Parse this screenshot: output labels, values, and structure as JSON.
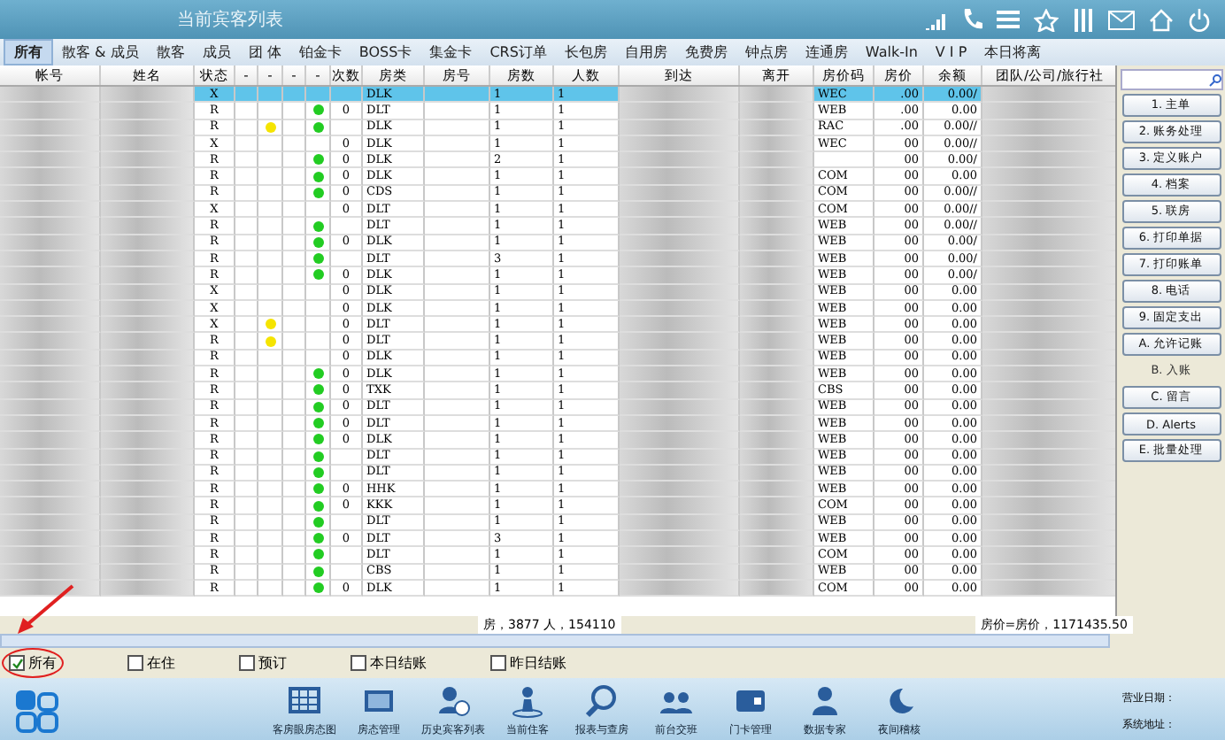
{
  "window": {
    "title": "当前宾客列表"
  },
  "tabs": [
    {
      "label": "所有",
      "selected": true
    },
    {
      "label": "散客 & 成员",
      "selected": false
    },
    {
      "label": "散客",
      "selected": false
    },
    {
      "label": "成员",
      "selected": false
    },
    {
      "label": "团 体",
      "selected": false
    },
    {
      "label": "铂金卡",
      "selected": false
    },
    {
      "label": "BOSS卡",
      "selected": false
    },
    {
      "label": "集金卡",
      "selected": false
    },
    {
      "label": "CRS订单",
      "selected": false
    },
    {
      "label": "长包房",
      "selected": false
    },
    {
      "label": "自用房",
      "selected": false
    },
    {
      "label": "免费房",
      "selected": false
    },
    {
      "label": "钟点房",
      "selected": false
    },
    {
      "label": "连通房",
      "selected": false
    },
    {
      "label": "Walk-In",
      "selected": false
    },
    {
      "label": "V I P",
      "selected": false
    },
    {
      "label": "本日将离",
      "selected": false
    }
  ],
  "table": {
    "columns": [
      "帐号",
      "姓名",
      "状态",
      "-",
      "-",
      "-",
      "-",
      "次数",
      "房类",
      "房号",
      "房数",
      "人数",
      "到达",
      "离开",
      "房价码",
      "房价",
      "余额",
      "团队/公司/旅行社"
    ],
    "rows": [
      {
        "status": "X",
        "yellow_dot": false,
        "green_dot": false,
        "count": "",
        "room_type": "DLK",
        "rooms": "1",
        "people": "1",
        "rate_code": "WEC",
        "rate": ".00",
        "balance": "0.00/",
        "selected": true
      },
      {
        "status": "R",
        "yellow_dot": false,
        "green_dot": true,
        "count": "0",
        "room_type": "DLT",
        "rooms": "1",
        "people": "1",
        "rate_code": "WEB",
        "rate": ".00",
        "balance": "0.00",
        "selected": false
      },
      {
        "status": "R",
        "yellow_dot": true,
        "green_dot": true,
        "count": "",
        "room_type": "DLK",
        "rooms": "1",
        "people": "1",
        "rate_code": "RAC",
        "rate": ".00",
        "balance": "0.00//",
        "selected": false
      },
      {
        "status": "X",
        "yellow_dot": false,
        "green_dot": false,
        "count": "0",
        "room_type": "DLK",
        "rooms": "1",
        "people": "1",
        "rate_code": "WEC",
        "rate": "00",
        "balance": "0.00//",
        "selected": false
      },
      {
        "status": "R",
        "yellow_dot": false,
        "green_dot": true,
        "count": "0",
        "room_type": "DLK",
        "rooms": "2",
        "people": "1",
        "rate_code": "",
        "rate": "00",
        "balance": "0.00/",
        "selected": false
      },
      {
        "status": "R",
        "yellow_dot": false,
        "green_dot": true,
        "count": "0",
        "room_type": "DLK",
        "rooms": "1",
        "people": "1",
        "rate_code": "COM",
        "rate": "00",
        "balance": "0.00",
        "selected": false
      },
      {
        "status": "R",
        "yellow_dot": false,
        "green_dot": true,
        "count": "0",
        "room_type": "CDS",
        "rooms": "1",
        "people": "1",
        "rate_code": "COM",
        "rate": "00",
        "balance": "0.00//",
        "selected": false
      },
      {
        "status": "X",
        "yellow_dot": false,
        "green_dot": false,
        "count": "0",
        "room_type": "DLT",
        "rooms": "1",
        "people": "1",
        "rate_code": "COM",
        "rate": "00",
        "balance": "0.00//",
        "selected": false
      },
      {
        "status": "R",
        "yellow_dot": false,
        "green_dot": true,
        "count": "",
        "room_type": "DLT",
        "rooms": "1",
        "people": "1",
        "rate_code": "WEB",
        "rate": "00",
        "balance": "0.00//",
        "selected": false
      },
      {
        "status": "R",
        "yellow_dot": false,
        "green_dot": true,
        "count": "0",
        "room_type": "DLK",
        "rooms": "1",
        "people": "1",
        "rate_code": "WEB",
        "rate": "00",
        "balance": "0.00/",
        "selected": false
      },
      {
        "status": "R",
        "yellow_dot": false,
        "green_dot": true,
        "count": "",
        "room_type": "DLT",
        "rooms": "3",
        "people": "1",
        "rate_code": "WEB",
        "rate": "00",
        "balance": "0.00/",
        "selected": false
      },
      {
        "status": "R",
        "yellow_dot": false,
        "green_dot": true,
        "count": "0",
        "room_type": "DLK",
        "rooms": "1",
        "people": "1",
        "rate_code": "WEB",
        "rate": "00",
        "balance": "0.00/",
        "selected": false
      },
      {
        "status": "X",
        "yellow_dot": false,
        "green_dot": false,
        "count": "0",
        "room_type": "DLK",
        "rooms": "1",
        "people": "1",
        "rate_code": "WEB",
        "rate": "00",
        "balance": "0.00",
        "selected": false
      },
      {
        "status": "X",
        "yellow_dot": false,
        "green_dot": false,
        "count": "0",
        "room_type": "DLK",
        "rooms": "1",
        "people": "1",
        "rate_code": "WEB",
        "rate": "00",
        "balance": "0.00",
        "selected": false
      },
      {
        "status": "X",
        "yellow_dot": true,
        "green_dot": false,
        "count": "0",
        "room_type": "DLT",
        "rooms": "1",
        "people": "1",
        "rate_code": "WEB",
        "rate": "00",
        "balance": "0.00",
        "selected": false
      },
      {
        "status": "R",
        "yellow_dot": true,
        "green_dot": false,
        "count": "0",
        "room_type": "DLT",
        "rooms": "1",
        "people": "1",
        "rate_code": "WEB",
        "rate": "00",
        "balance": "0.00",
        "selected": false
      },
      {
        "status": "R",
        "yellow_dot": false,
        "green_dot": false,
        "count": "0",
        "room_type": "DLK",
        "rooms": "1",
        "people": "1",
        "rate_code": "WEB",
        "rate": "00",
        "balance": "0.00",
        "selected": false
      },
      {
        "status": "R",
        "yellow_dot": false,
        "green_dot": true,
        "count": "0",
        "room_type": "DLK",
        "rooms": "1",
        "people": "1",
        "rate_code": "WEB",
        "rate": "00",
        "balance": "0.00",
        "selected": false
      },
      {
        "status": "R",
        "yellow_dot": false,
        "green_dot": true,
        "count": "0",
        "room_type": "TXK",
        "rooms": "1",
        "people": "1",
        "rate_code": "CBS",
        "rate": "00",
        "balance": "0.00",
        "selected": false
      },
      {
        "status": "R",
        "yellow_dot": false,
        "green_dot": true,
        "count": "0",
        "room_type": "DLT",
        "rooms": "1",
        "people": "1",
        "rate_code": "WEB",
        "rate": "00",
        "balance": "0.00",
        "selected": false
      },
      {
        "status": "R",
        "yellow_dot": false,
        "green_dot": true,
        "count": "0",
        "room_type": "DLT",
        "rooms": "1",
        "people": "1",
        "rate_code": "WEB",
        "rate": "00",
        "balance": "0.00",
        "selected": false
      },
      {
        "status": "R",
        "yellow_dot": false,
        "green_dot": true,
        "count": "0",
        "room_type": "DLK",
        "rooms": "1",
        "people": "1",
        "rate_code": "WEB",
        "rate": "00",
        "balance": "0.00",
        "selected": false
      },
      {
        "status": "R",
        "yellow_dot": false,
        "green_dot": true,
        "count": "",
        "room_type": "DLT",
        "rooms": "1",
        "people": "1",
        "rate_code": "WEB",
        "rate": "00",
        "balance": "0.00",
        "selected": false
      },
      {
        "status": "R",
        "yellow_dot": false,
        "green_dot": true,
        "count": "",
        "room_type": "DLT",
        "rooms": "1",
        "people": "1",
        "rate_code": "WEB",
        "rate": "00",
        "balance": "0.00",
        "selected": false
      },
      {
        "status": "R",
        "yellow_dot": false,
        "green_dot": true,
        "count": "0",
        "room_type": "HHK",
        "rooms": "1",
        "people": "1",
        "rate_code": "WEB",
        "rate": "00",
        "balance": "0.00",
        "selected": false
      },
      {
        "status": "R",
        "yellow_dot": false,
        "green_dot": true,
        "count": "0",
        "room_type": "KKK",
        "rooms": "1",
        "people": "1",
        "rate_code": "COM",
        "rate": "00",
        "balance": "0.00",
        "selected": false
      },
      {
        "status": "R",
        "yellow_dot": false,
        "green_dot": true,
        "count": "",
        "room_type": "DLT",
        "rooms": "1",
        "people": "1",
        "rate_code": "WEB",
        "rate": "00",
        "balance": "0.00",
        "selected": false
      },
      {
        "status": "R",
        "yellow_dot": false,
        "green_dot": true,
        "count": "0",
        "room_type": "DLT",
        "rooms": "3",
        "people": "1",
        "rate_code": "WEB",
        "rate": "00",
        "balance": "0.00",
        "selected": false
      },
      {
        "status": "R",
        "yellow_dot": false,
        "green_dot": true,
        "count": "",
        "room_type": "DLT",
        "rooms": "1",
        "people": "1",
        "rate_code": "COM",
        "rate": "00",
        "balance": "0.00",
        "selected": false
      },
      {
        "status": "R",
        "yellow_dot": false,
        "green_dot": true,
        "count": "",
        "room_type": "CBS",
        "rooms": "1",
        "people": "1",
        "rate_code": "WEB",
        "rate": "00",
        "balance": "0.00",
        "selected": false
      },
      {
        "status": "R",
        "yellow_dot": false,
        "green_dot": true,
        "count": "0",
        "room_type": "DLK",
        "rooms": "1",
        "people": "1",
        "rate_code": "COM",
        "rate": "00",
        "balance": "0.00",
        "selected": false
      }
    ]
  },
  "summary": {
    "rooms_people": "房，3877 人，154110",
    "rate_total": "房价=房价，1171435.50"
  },
  "side_buttons": [
    {
      "label": "1. 主单",
      "disabled": false
    },
    {
      "label": "2. 账务处理",
      "disabled": false
    },
    {
      "label": "3. 定义账户",
      "disabled": false
    },
    {
      "label": "4. 档案",
      "disabled": false
    },
    {
      "label": "5. 联房",
      "disabled": false
    },
    {
      "label": "6. 打印单据",
      "disabled": false
    },
    {
      "label": "7. 打印账单",
      "disabled": false
    },
    {
      "label": "8. 电话",
      "disabled": false
    },
    {
      "label": "9. 固定支出",
      "disabled": false
    },
    {
      "label": "A. 允许记账",
      "disabled": false
    },
    {
      "label": "B. 入账",
      "disabled": true
    },
    {
      "label": "C. 留言",
      "disabled": false
    },
    {
      "label": "D. Alerts",
      "disabled": false
    },
    {
      "label": "E. 批量处理",
      "disabled": false
    }
  ],
  "filters": [
    {
      "label": "所有",
      "checked": true
    },
    {
      "label": "在住",
      "checked": false
    },
    {
      "label": "预订",
      "checked": false
    },
    {
      "label": "本日结账",
      "checked": false
    },
    {
      "label": "昨日结账",
      "checked": false
    }
  ],
  "taskbar": [
    {
      "label": "客房眼房态图",
      "kind": "grid"
    },
    {
      "label": "房态管理",
      "kind": "board"
    },
    {
      "label": "历史宾客列表",
      "kind": "history"
    },
    {
      "label": "当前住客",
      "kind": "guest"
    },
    {
      "label": "报表与查房",
      "kind": "search"
    },
    {
      "label": "前台交班",
      "kind": "handover"
    },
    {
      "label": "门卡管理",
      "kind": "card"
    },
    {
      "label": "数据专家",
      "kind": "expert"
    },
    {
      "label": "夜间稽核",
      "kind": "night"
    }
  ],
  "status": {
    "business_date": "营业日期：",
    "system_address": "系统地址："
  }
}
